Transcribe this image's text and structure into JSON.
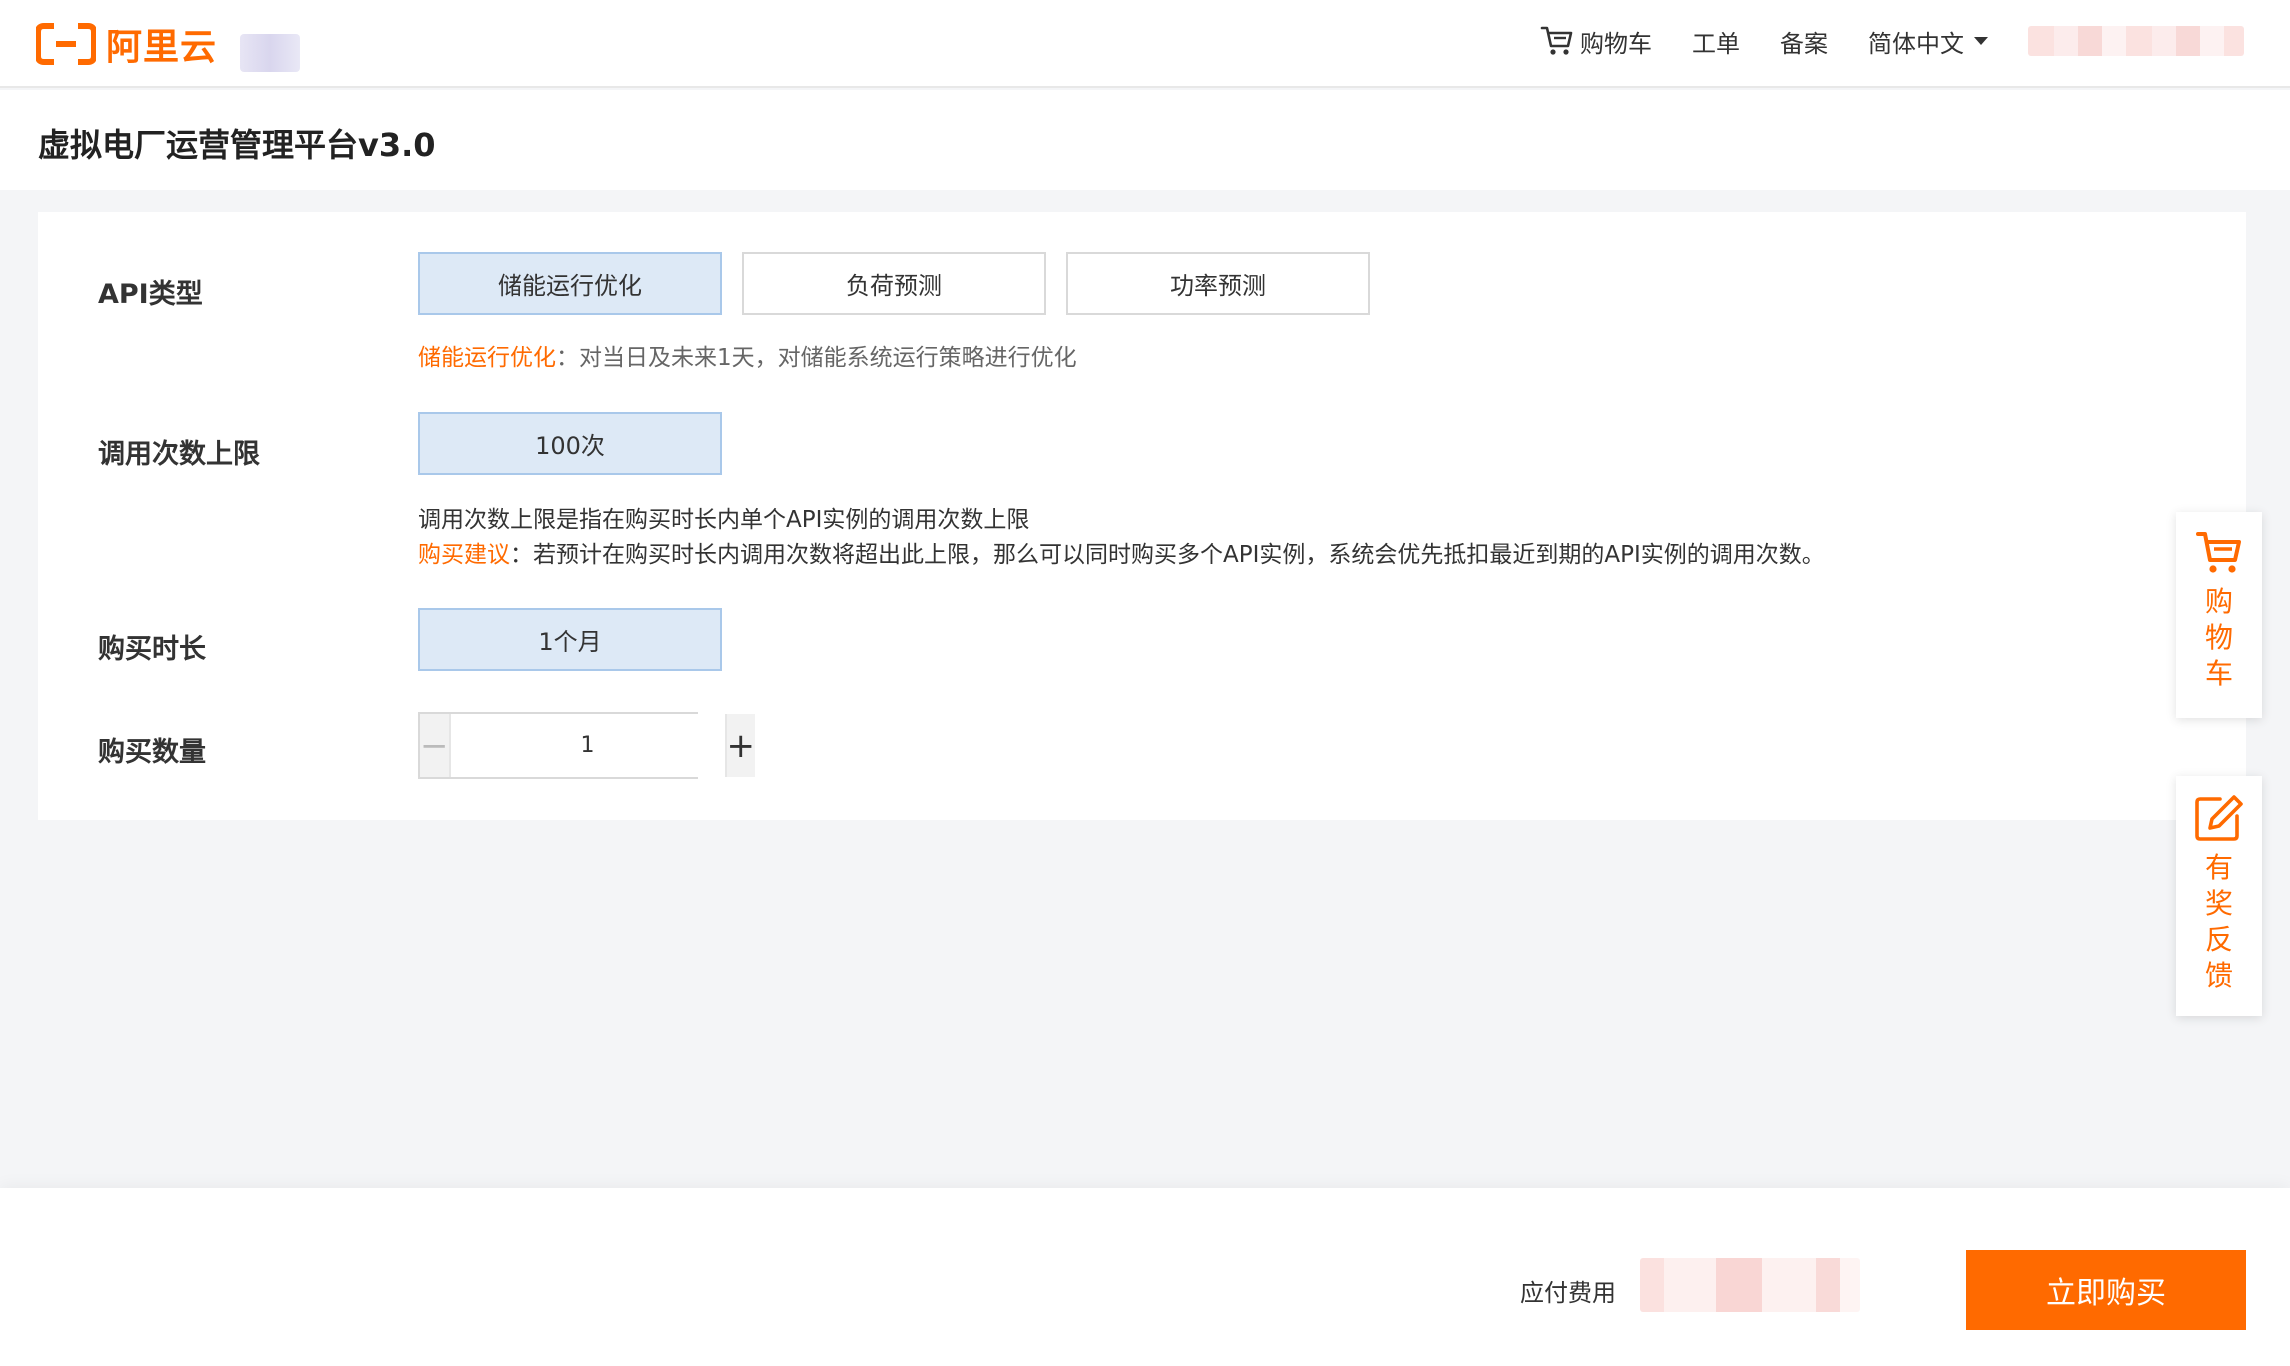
{
  "header": {
    "brand": "阿里云",
    "nav": {
      "cart": "购物车",
      "tickets": "工单",
      "filing": "备案",
      "language": "简体中文"
    }
  },
  "page": {
    "title": "虚拟电厂运营管理平台v3.0"
  },
  "form": {
    "api_type": {
      "label": "API类型",
      "options": [
        "储能运行优化",
        "负荷预测",
        "功率预测"
      ],
      "selected": "储能运行优化",
      "desc_highlight": "储能运行优化",
      "desc_text": "：对当日及未来1天，对储能系统运行策略进行优化"
    },
    "call_limit": {
      "label": "调用次数上限",
      "value": "100次",
      "desc_line1": "调用次数上限是指在购买时长内单个API实例的调用次数上限",
      "advice_highlight": "购买建议",
      "advice_text": "：若预计在购买时长内调用次数将超出此上限，那么可以同时购买多个API实例，系统会优先抵扣最近到期的API实例的调用次数。"
    },
    "duration": {
      "label": "购买时长",
      "value": "1个月"
    },
    "quantity": {
      "label": "购买数量",
      "value": "1"
    }
  },
  "float_tools": {
    "cart": [
      "购",
      "物",
      "车"
    ],
    "feedback": [
      "有",
      "奖",
      "反",
      "馈"
    ]
  },
  "footer": {
    "fee_label": "应付费用",
    "buy_button": "立即购买"
  },
  "colors": {
    "accent": "#ff6a00",
    "selected_bg": "#dde9f6",
    "selected_border": "#a9c8ea"
  }
}
